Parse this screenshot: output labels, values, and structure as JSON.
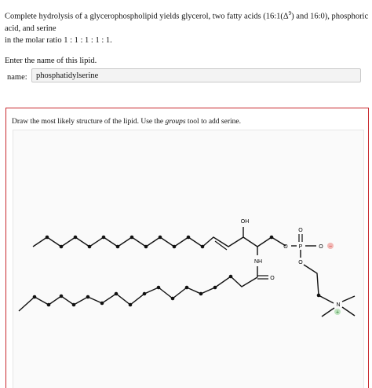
{
  "question": {
    "line1": "Complete hydrolysis of a glycerophospholipid yields glycerol, two fatty acids (16:1(Δ",
    "line1_sup": "9",
    "line1_rest": ") and 16:0), phosphoric acid, and serine",
    "line2": "in the molar ratio 1 : 1 : 1 : 1 : 1.",
    "prompt": "Enter the name of this lipid."
  },
  "answer": {
    "label": "name:",
    "value": "phosphatidylserine"
  },
  "editor": {
    "instruction_before": "Draw the most likely structure of the lipid. Use the ",
    "instruction_em": "groups",
    "instruction_after": " tool to add serine."
  },
  "structure": {
    "atoms": {
      "hydroxyl": "OH",
      "amide_nh": "NH",
      "carbonyl_o": "O",
      "ester_o": "O",
      "phosphate_top_o": "O",
      "phosphorus": "P",
      "phosphate_right_o": "O",
      "phosphate_bottom_o": "O",
      "nitrogen": "N"
    },
    "charges": {
      "oxygen_minus": "−",
      "nitrogen_plus": "+"
    },
    "colors": {
      "bond": "#111111",
      "minus_badge": "#f2b8b5",
      "minus_text": "#c62828",
      "plus_badge": "#bfe3c0",
      "plus_text": "#2e7d32",
      "frame": "#c8282e"
    }
  }
}
